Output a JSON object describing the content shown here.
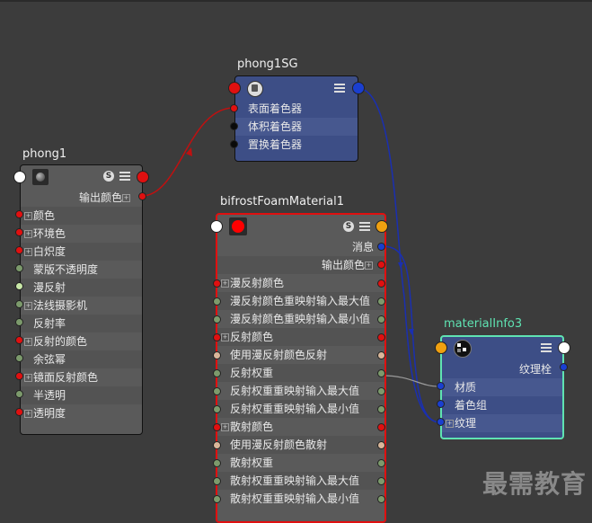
{
  "phong1SG": {
    "title": "phong1SG",
    "rows": [
      "表面着色器",
      "体积着色器",
      "置换着色器"
    ]
  },
  "phong1": {
    "title": "phong1",
    "output_label": "输出颜色",
    "rows": [
      "颜色",
      "环境色",
      "白炽度",
      "蒙版不透明度",
      "漫反射",
      "法线摄影机",
      "反射率",
      "反射的颜色",
      "余弦幂",
      "镜面反射颜色",
      "半透明",
      "透明度"
    ]
  },
  "bifrost": {
    "title": "bifrostFoamMaterial1",
    "message_label": "消息",
    "output_label": "输出颜色",
    "rows": [
      "漫反射颜色",
      "漫反射颜色重映射输入最大值",
      "漫反射颜色重映射输入最小值",
      "反射颜色",
      "使用漫反射颜色反射",
      "反射权重",
      "反射权重重映射输入最大值",
      "反射权重重映射输入最小值",
      "散射颜色",
      "使用漫反射颜色散射",
      "散射权重",
      "散射权重重映射输入最大值",
      "散射权重重映射输入最小值"
    ]
  },
  "materialInfo3": {
    "title": "materialInfo3",
    "output_label": "纹理栓",
    "rows": [
      "材质",
      "着色组",
      "纹理"
    ]
  },
  "watermark": "最需教育",
  "icons": {
    "s_badge": "S",
    "plus": "⊞"
  },
  "colors": {
    "background": "#3c3c3c",
    "node_gray": "#5a5a5a",
    "node_blue": "#3d4e86",
    "selected_border": "#e01010",
    "highlight_border": "#5fe3b2",
    "wire_red": "#c01010",
    "wire_blue": "#1a2fb0"
  }
}
